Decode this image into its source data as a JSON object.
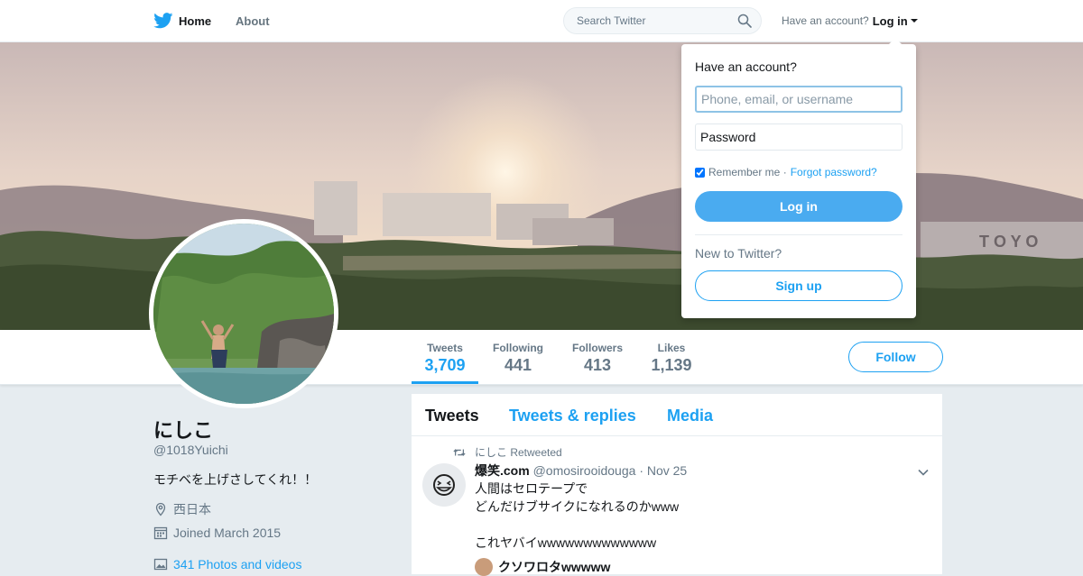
{
  "nav": {
    "home_label": "Home",
    "about_label": "About",
    "search_placeholder": "Search Twitter",
    "account_prompt": "Have an account?",
    "login_label": "Log in"
  },
  "profile": {
    "name": "にしこ",
    "handle": "@1018Yuichi",
    "bio": "モチベを上げさしてくれ！！",
    "location": "西日本",
    "joined": "Joined March 2015",
    "photos_link": "341 Photos and videos"
  },
  "stats": [
    {
      "label": "Tweets",
      "value": "3,709"
    },
    {
      "label": "Following",
      "value": "441"
    },
    {
      "label": "Followers",
      "value": "413"
    },
    {
      "label": "Likes",
      "value": "1,139"
    }
  ],
  "follow_label": "Follow",
  "timeline": {
    "tabs": [
      "Tweets",
      "Tweets & replies",
      "Media"
    ],
    "tweet": {
      "retweet_context": "にしこ Retweeted",
      "name": "爆笑.com",
      "handle": "@omosirooidouga",
      "date": "· Nov 25",
      "lines": [
        "人間はセロテープで",
        "どんだけブサイクになれるのかwww",
        "",
        "これヤバイwwwwwwwwwwwww"
      ],
      "quote_name": "クソワロタwwwww"
    }
  },
  "login_dropdown": {
    "title": "Have an account?",
    "username_placeholder": "Phone, email, or username",
    "password_placeholder": "Password",
    "remember_label": "Remember me ·",
    "forgot_label": "Forgot password?",
    "login_button": "Log in",
    "new_prompt": "New to Twitter?",
    "signup_button": "Sign up"
  },
  "banner": {
    "sign_text": "T O Y O"
  },
  "colors": {
    "accent": "#1da1f2",
    "background": "#e6ecf0"
  }
}
